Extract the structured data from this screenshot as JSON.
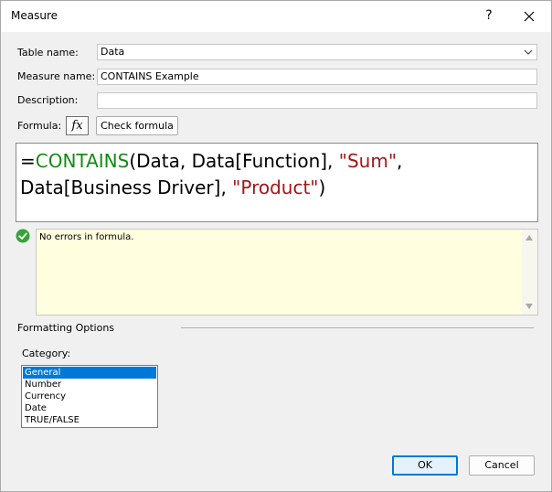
{
  "window": {
    "title": "Measure",
    "help_label": "?",
    "close_icon": "close-icon"
  },
  "form": {
    "table_name_label": "Table name:",
    "table_name_value": "Data",
    "measure_name_label": "Measure name:",
    "measure_name_value": "CONTAINS Example",
    "description_label": "Description:",
    "description_value": "",
    "formula_label": "Formula:",
    "fx_label": "fx",
    "check_formula_label": "Check formula"
  },
  "formula": {
    "equals": "=",
    "function": "CONTAINS",
    "part1": "(Data, Data[Function], ",
    "str1": "\"Sum\"",
    "part2": ", ",
    "part3": "Data[Business Driver], ",
    "str2": "\"Product\"",
    "close": ")"
  },
  "status": {
    "icon": "check-circle-icon",
    "message": "No errors in formula."
  },
  "formatting": {
    "section_title": "Formatting Options",
    "category_label": "Category:",
    "categories": [
      "General",
      "Number",
      "Currency",
      "Date",
      "TRUE/FALSE"
    ],
    "selected_category": "General"
  },
  "buttons": {
    "ok_label": "OK",
    "cancel_label": "Cancel"
  },
  "colors": {
    "function": "#158a15",
    "string": "#a31515",
    "status_background": "#ffffdf",
    "selection": "#0078d7",
    "success_icon": "#36a23a"
  }
}
